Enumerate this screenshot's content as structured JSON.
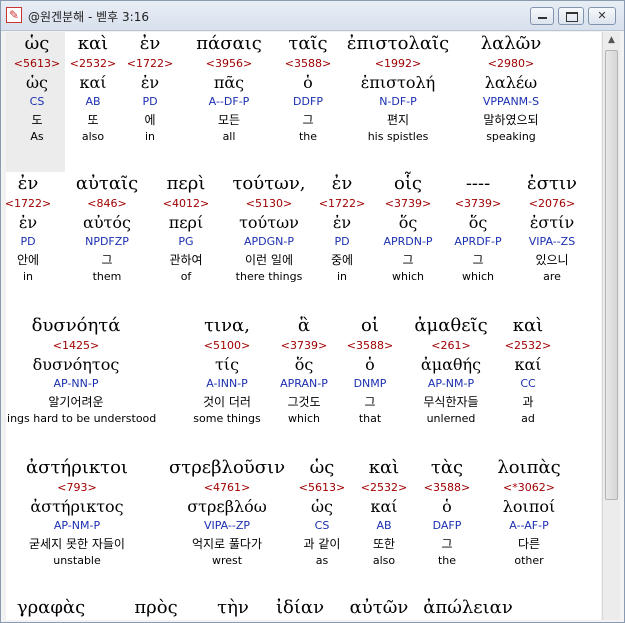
{
  "window": {
    "title": "@원겐분해 - 벧후 3:16"
  },
  "rows": [
    [
      {
        "greek": "ὡς",
        "strong": "<5613>",
        "lemma": "ὡς",
        "parsing": "CS",
        "korean": "도",
        "english": "As"
      },
      {
        "greek": "καὶ",
        "strong": "<2532>",
        "lemma": "καί",
        "parsing": "AB",
        "korean": "또",
        "english": "also"
      },
      {
        "greek": "ἐν",
        "strong": "<1722>",
        "lemma": "ἐν",
        "parsing": "PD",
        "korean": "에",
        "english": "in"
      },
      {
        "greek": "πάσαις",
        "strong": "<3956>",
        "lemma": "πᾶς",
        "parsing": "A--DF-P",
        "korean": "모든",
        "english": "all"
      },
      {
        "greek": "ταῖς",
        "strong": "<3588>",
        "lemma": "ὁ",
        "parsing": "DDFP",
        "korean": "그",
        "english": "the"
      },
      {
        "greek": "ἐπιστολαῖς",
        "strong": "<1992>",
        "lemma": "ἐπιστολή",
        "parsing": "N-DF-P",
        "korean": "편지",
        "english": "his spistles"
      },
      {
        "greek": "λαλῶν",
        "strong": "<2980>",
        "lemma": "λαλέω",
        "parsing": "VPPANM-S",
        "korean": "말하였으되",
        "english": "speaking"
      }
    ],
    [
      {
        "greek": "ἐν",
        "strong": "<1722>",
        "lemma": "ἐν",
        "parsing": "PD",
        "korean": "안에",
        "english": "in"
      },
      {
        "greek": "αὐταῖς",
        "strong": "<846>",
        "lemma": "αὐτός",
        "parsing": "NPDFZP",
        "korean": "그",
        "english": "them"
      },
      {
        "greek": "περὶ",
        "strong": "<4012>",
        "lemma": "περί",
        "parsing": "PG",
        "korean": "관하여",
        "english": "of"
      },
      {
        "greek": "τούτων,",
        "strong": "<5130>",
        "lemma": "τούτων",
        "parsing": "APDGN-P",
        "korean": "이런 일에",
        "english": "there things"
      },
      {
        "greek": "ἐν",
        "strong": "<1722>",
        "lemma": "ἐν",
        "parsing": "PD",
        "korean": "중에",
        "english": "in"
      },
      {
        "greek": "οἷς",
        "strong": "<3739>",
        "lemma": "ὅς",
        "parsing": "APRDN-P",
        "korean": "그",
        "english": "which"
      },
      {
        "greek": "----",
        "strong": "<3739>",
        "lemma": "ὅς",
        "parsing": "APRDF-P",
        "korean": "그",
        "english": "which"
      },
      {
        "greek": "ἐστιν",
        "strong": "<2076>",
        "lemma": "ἐστίν",
        "parsing": "VIPA--ZS",
        "korean": "있으니",
        "english": "are"
      }
    ],
    [
      {
        "greek": "δυσνόητά",
        "strong": "<1425>",
        "lemma": "δυσνόητος",
        "parsing": "AP-NN-P",
        "korean": "알기어려운",
        "english": "things hard to be understood"
      },
      {
        "greek": "τινα,",
        "strong": "<5100>",
        "lemma": "τίς",
        "parsing": "A-INN-P",
        "korean": "것이 더러",
        "english": "some things"
      },
      {
        "greek": "ἃ",
        "strong": "<3739>",
        "lemma": "ὅς",
        "parsing": "APRAN-P",
        "korean": "그것도",
        "english": "which"
      },
      {
        "greek": "οἱ",
        "strong": "<3588>",
        "lemma": "ὁ",
        "parsing": "DNMP",
        "korean": "그",
        "english": "that"
      },
      {
        "greek": "ἀμαθεῖς",
        "strong": "<261>",
        "lemma": "ἀμαθής",
        "parsing": "AP-NM-P",
        "korean": "무식한자들",
        "english": "unlerned"
      },
      {
        "greek": "καὶ",
        "strong": "<2532>",
        "lemma": "καί",
        "parsing": "CC",
        "korean": "과",
        "english": "ad"
      }
    ],
    [
      {
        "greek": "ἀστήρικτοι",
        "strong": "<793>",
        "lemma": "ἀστήρικτος",
        "parsing": "AP-NM-P",
        "korean": "굳세지 못한 자들이",
        "english": "unstable"
      },
      {
        "greek": "στρεβλοῦσιν",
        "strong": "<4761>",
        "lemma": "στρεβλόω",
        "parsing": "VIPA--ZP",
        "korean": "억지로 풀다가",
        "english": "wrest"
      },
      {
        "greek": "ὡς",
        "strong": "<5613>",
        "lemma": "ὡς",
        "parsing": "CS",
        "korean": "과 같이",
        "english": "as"
      },
      {
        "greek": "καὶ",
        "strong": "<2532>",
        "lemma": "καί",
        "parsing": "AB",
        "korean": "또한",
        "english": "also"
      },
      {
        "greek": "τὰς",
        "strong": "<3588>",
        "lemma": "ὁ",
        "parsing": "DAFP",
        "korean": "그",
        "english": "the"
      },
      {
        "greek": "λοιπὰς",
        "strong": "<*3062>",
        "lemma": "λοιποί",
        "parsing": "A--AF-P",
        "korean": "다른",
        "english": "other"
      }
    ],
    [
      {
        "greek": "γραφὰς"
      },
      {
        "greek": "πρὸς"
      },
      {
        "greek": "τὴν"
      },
      {
        "greek": "ἰδίαν"
      },
      {
        "greek": "αὐτῶν"
      },
      {
        "greek": "ἀπώλειαν"
      }
    ]
  ],
  "colors": {
    "strong": "#a00000",
    "parsing": "#1a2fb0",
    "highlight": "#ececec"
  },
  "icons": [
    "app-icon",
    "minimize-icon",
    "maximize-icon",
    "close-icon",
    "scroll-up-arrow-icon"
  ]
}
